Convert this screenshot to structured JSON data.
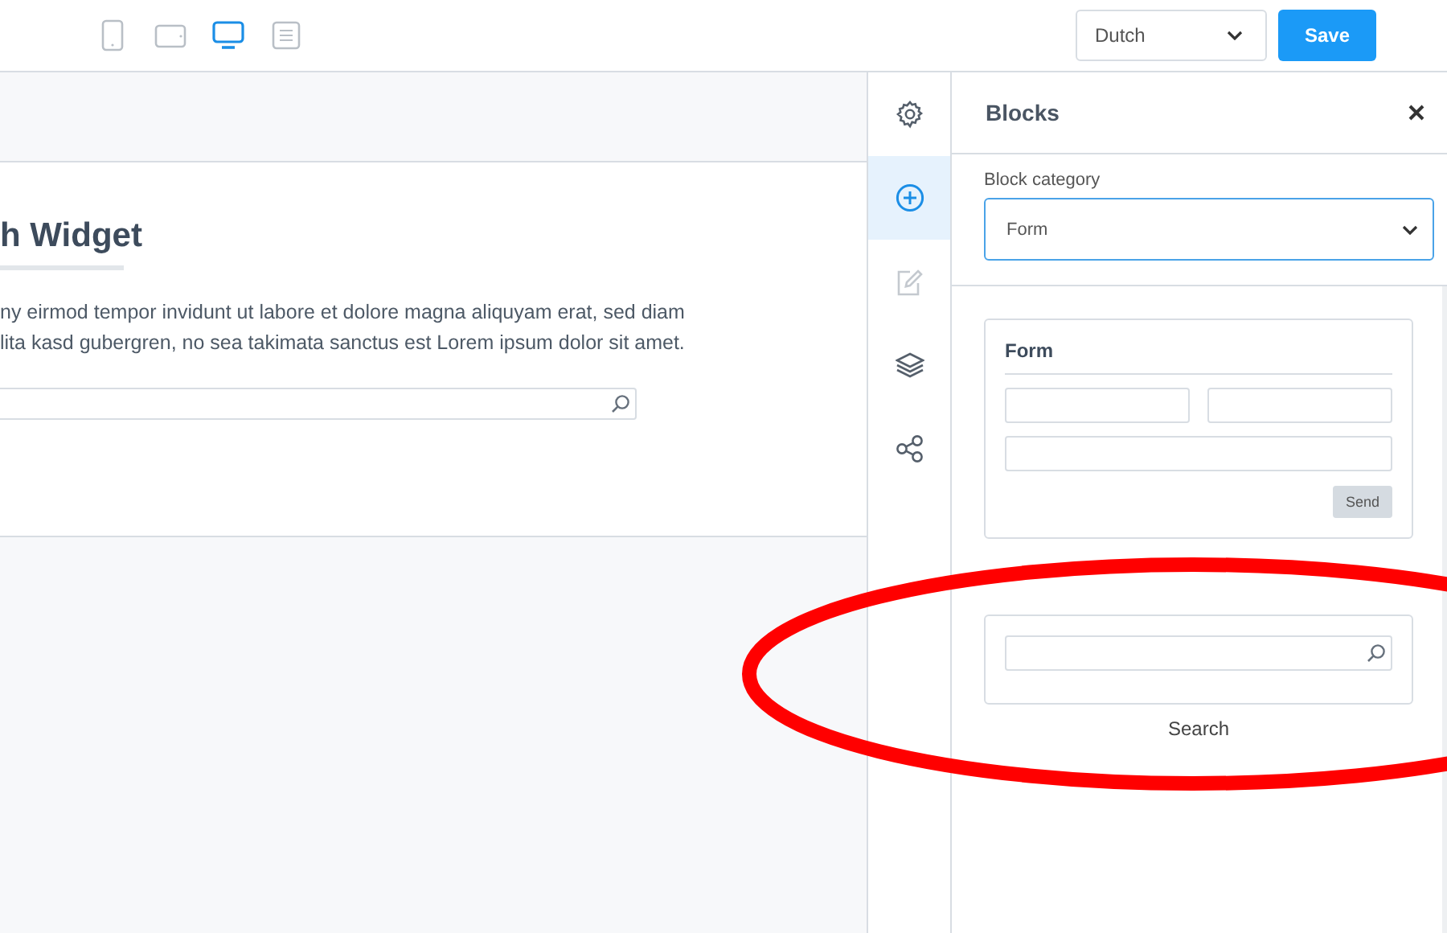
{
  "toolbar": {
    "devices": [
      {
        "kind": "phone",
        "selected": false
      },
      {
        "kind": "tablet",
        "selected": false
      },
      {
        "kind": "desktop",
        "selected": true
      },
      {
        "kind": "text",
        "selected": false
      }
    ],
    "language": {
      "value": "Dutch"
    },
    "save_button": "Save"
  },
  "canvas": {
    "title": "h Widget",
    "paragraph_lines": [
      "ny eirmod tempor invidunt ut labore et dolore magna aliquyam erat, sed diam",
      "lita kasd gubergren, no sea takimata sanctus est Lorem ipsum dolor sit amet."
    ]
  },
  "rail": [
    {
      "kind": "settings",
      "selected": false,
      "disabled": false
    },
    {
      "kind": "add",
      "selected": true,
      "disabled": false
    },
    {
      "kind": "edit",
      "selected": false,
      "disabled": true
    },
    {
      "kind": "layers",
      "selected": false,
      "disabled": false
    },
    {
      "kind": "share",
      "selected": false,
      "disabled": false
    }
  ],
  "panel": {
    "title": "Blocks",
    "category_label": "Block category",
    "category_value": "Form",
    "blocks": [
      {
        "kind": "form",
        "title": "Form",
        "button": "Send"
      },
      {
        "kind": "search",
        "caption": "Search"
      }
    ]
  }
}
